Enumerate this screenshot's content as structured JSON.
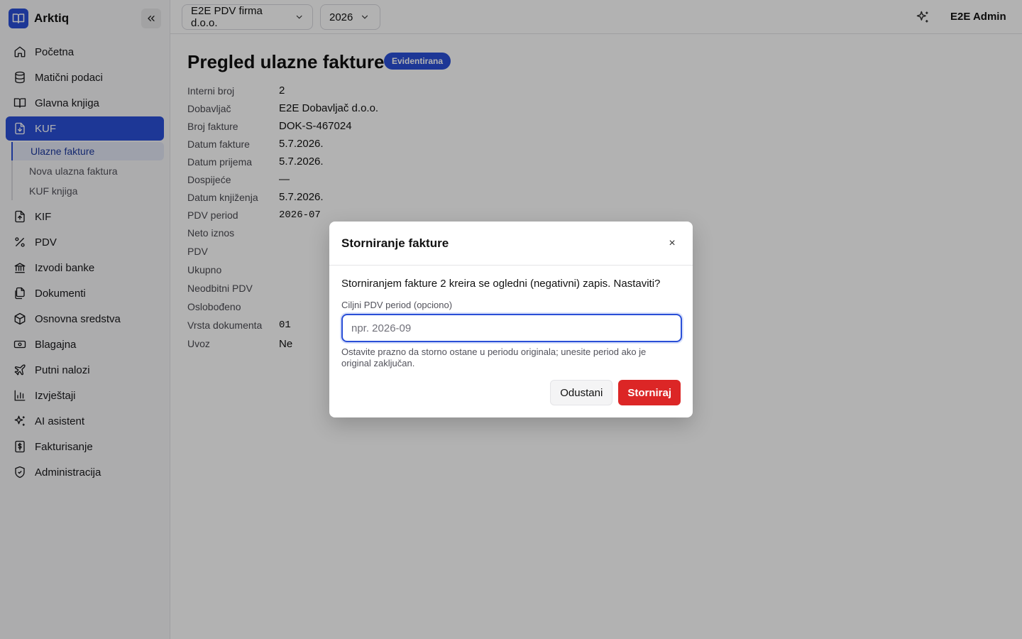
{
  "brand": {
    "name": "Arktiq"
  },
  "sidebar": {
    "items": [
      {
        "label": "Početna",
        "icon": "home-icon"
      },
      {
        "label": "Matični podaci",
        "icon": "database-icon"
      },
      {
        "label": "Glavna knjiga",
        "icon": "book-icon"
      },
      {
        "label": "KUF",
        "icon": "file-download-icon",
        "active": true,
        "children": [
          {
            "label": "Ulazne fakture",
            "active": true
          },
          {
            "label": "Nova ulazna faktura"
          },
          {
            "label": "KUF knjiga"
          }
        ]
      },
      {
        "label": "KIF",
        "icon": "file-upload-icon"
      },
      {
        "label": "PDV",
        "icon": "percent-icon"
      },
      {
        "label": "Izvodi banke",
        "icon": "bank-icon"
      },
      {
        "label": "Dokumenti",
        "icon": "documents-icon"
      },
      {
        "label": "Osnovna sredstva",
        "icon": "box-icon"
      },
      {
        "label": "Blagajna",
        "icon": "cash-icon"
      },
      {
        "label": "Putni nalozi",
        "icon": "plane-icon"
      },
      {
        "label": "Izvještaji",
        "icon": "bar-chart-icon"
      },
      {
        "label": "AI asistent",
        "icon": "sparkles-icon"
      },
      {
        "label": "Fakturisanje",
        "icon": "invoice-dollar-icon"
      },
      {
        "label": "Administracija",
        "icon": "shield-icon"
      }
    ]
  },
  "topbar": {
    "company": "E2E PDV firma d.o.o.",
    "year": "2026",
    "user": "E2E Admin"
  },
  "page": {
    "title": "Pregled ulazne fakture",
    "status": "Evidentirana",
    "details": [
      {
        "label": "Interni broj",
        "value": "2"
      },
      {
        "label": "Dobavljač",
        "value": "E2E Dobavljač d.o.o."
      },
      {
        "label": "Broj fakture",
        "value": "DOK-S-467024"
      },
      {
        "label": "Datum fakture",
        "value": "5.7.2026."
      },
      {
        "label": "Datum prijema",
        "value": "5.7.2026."
      },
      {
        "label": "Dospijeće",
        "value": "—"
      },
      {
        "label": "Datum knjiženja",
        "value": "5.7.2026."
      },
      {
        "label": "PDV period",
        "value": "2026-07",
        "mono": true
      },
      {
        "label": "Neto iznos",
        "value": ""
      },
      {
        "label": "PDV",
        "value": ""
      },
      {
        "label": "Ukupno",
        "value": ""
      },
      {
        "label": "Neodbitni PDV",
        "value": ""
      },
      {
        "label": "Oslobođeno",
        "value": ""
      },
      {
        "label": "Vrsta dokumenta",
        "value": "01",
        "mono": true
      },
      {
        "label": "Uvoz",
        "value": "Ne"
      }
    ]
  },
  "modal": {
    "title": "Storniranje fakture",
    "close": "×",
    "message": "Storniranjem fakture 2 kreira se ogledni (negativni) zapis. Nastaviti?",
    "field_label": "Ciljni PDV period (opciono)",
    "field_value": "",
    "field_placeholder": "npr. 2026-09",
    "hint": "Ostavite prazno da storno ostane u periodu originala; unesite period ako je original zaključan.",
    "cancel_label": "Odustani",
    "confirm_label": "Storniraj"
  },
  "colors": {
    "accent": "#2a4fd7",
    "danger": "#dc2626"
  }
}
